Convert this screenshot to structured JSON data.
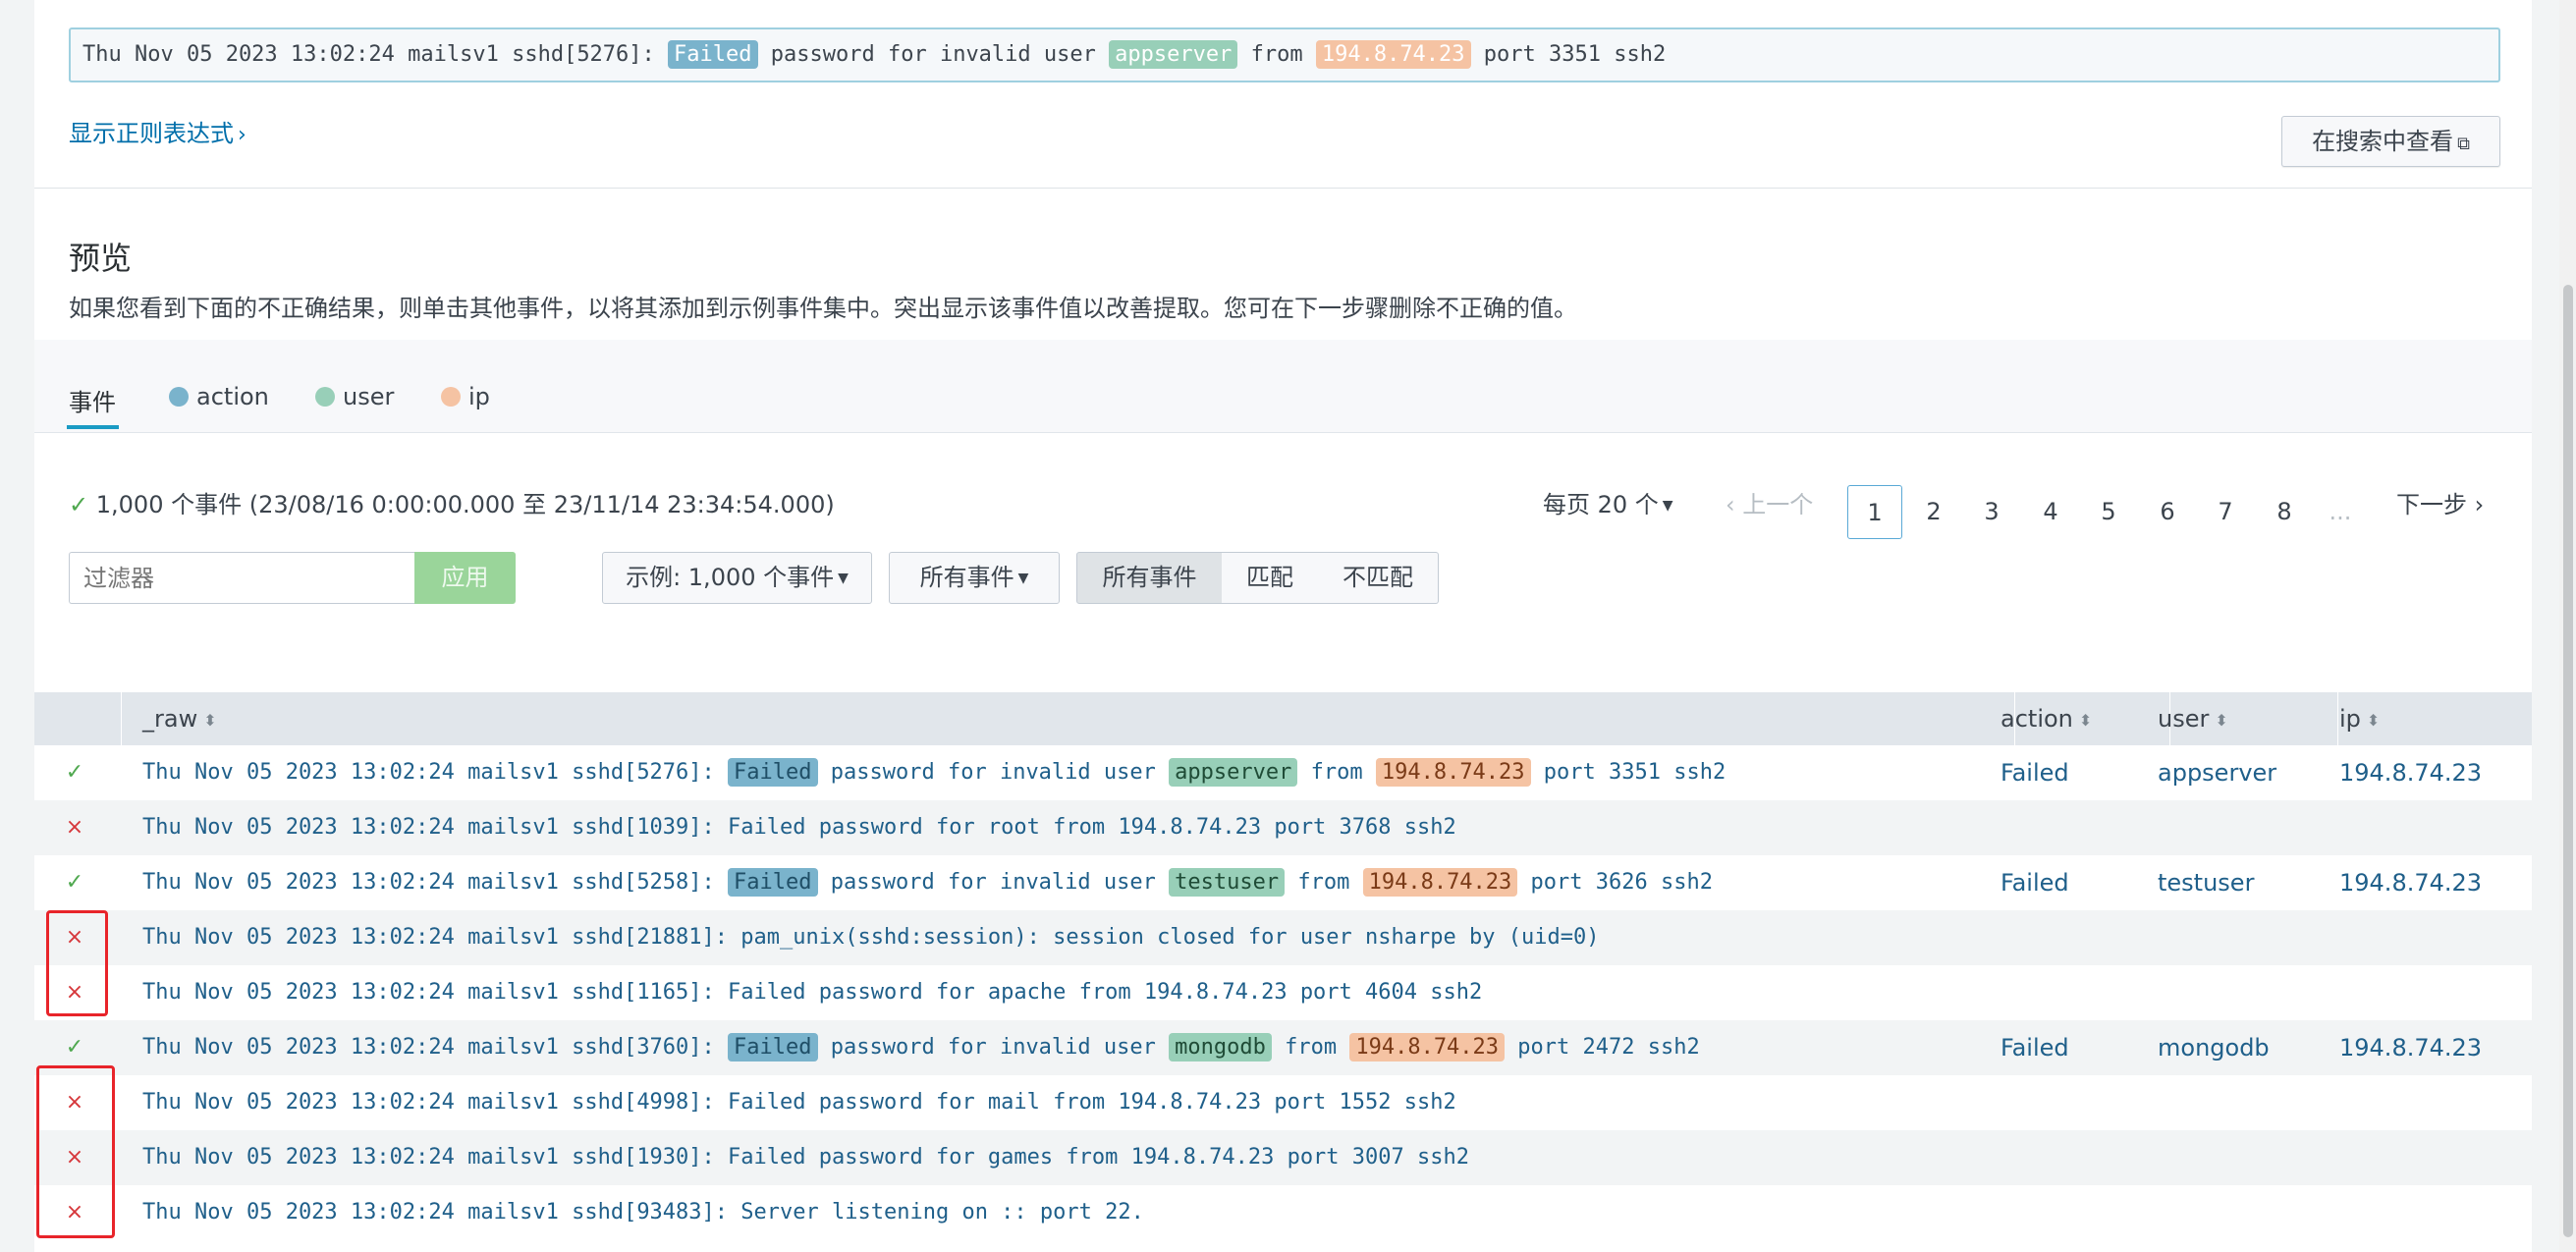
{
  "sample_event": {
    "prefix": "Thu Nov 05 2023 13:02:24 mailsv1 sshd[5276]: ",
    "action": "Failed",
    "middle1": " password for invalid user ",
    "user": "appserver",
    "middle2": " from ",
    "ip": "194.8.74.23",
    "suffix": " port 3351 ssh2"
  },
  "regex_link": "显示正则表达式",
  "view_in_search": "在搜索中查看",
  "preview": {
    "title": "预览",
    "description": "如果您看到下面的不正确结果，则单击其他事件，以将其添加到示例事件集中。突出显示该事件值以改善提取。您可在下一步骤删除不正确的值。"
  },
  "tabs": {
    "events": "事件",
    "action": "action",
    "user": "user",
    "ip": "ip"
  },
  "colors": {
    "action": "#7ab3cc",
    "user": "#98cfb8",
    "ip": "#f5c3a3",
    "accent": "#1a9bc4"
  },
  "event_count": "1,000 个事件 (23/08/16 0:00:00.000 至 23/11/14 23:34:54.000)",
  "filter": {
    "placeholder": "过滤器",
    "apply": "应用"
  },
  "sample_dropdown": "示例: 1,000 个事件",
  "all_events_dropdown": "所有事件",
  "match_segments": [
    "所有事件",
    "匹配",
    "不匹配"
  ],
  "pager": {
    "per_page": "每页 20 个",
    "prev": "上一个",
    "pages": [
      "1",
      "2",
      "3",
      "4",
      "5",
      "6",
      "7",
      "8"
    ],
    "ellipsis": "...",
    "next": "下一步",
    "current": "1"
  },
  "table": {
    "headers": {
      "raw": "_raw",
      "action": "action",
      "user": "user",
      "ip": "ip"
    },
    "rows": [
      {
        "ok": true,
        "prefix": "Thu Nov 05 2023 13:02:24 mailsv1 sshd[5276]: ",
        "action": "Failed",
        "middle1": " password for invalid user ",
        "user": "appserver",
        "middle2": " from ",
        "ip": "194.8.74.23",
        "suffix": " port 3351 ssh2",
        "col_action": "Failed",
        "col_user": "appserver",
        "col_ip": "194.8.74.23"
      },
      {
        "ok": false,
        "text": "Thu Nov 05 2023 13:02:24 mailsv1 sshd[1039]: Failed password for root from 194.8.74.23 port 3768 ssh2"
      },
      {
        "ok": true,
        "prefix": "Thu Nov 05 2023 13:02:24 mailsv1 sshd[5258]: ",
        "action": "Failed",
        "middle1": " password for invalid user ",
        "user": "testuser",
        "middle2": " from ",
        "ip": "194.8.74.23",
        "suffix": " port 3626 ssh2",
        "col_action": "Failed",
        "col_user": "testuser",
        "col_ip": "194.8.74.23"
      },
      {
        "ok": false,
        "text": "Thu Nov 05 2023 13:02:24 mailsv1 sshd[21881]: pam_unix(sshd:session): session closed for user nsharpe by (uid=0)"
      },
      {
        "ok": false,
        "text": "Thu Nov 05 2023 13:02:24 mailsv1 sshd[1165]: Failed password for apache from 194.8.74.23 port 4604 ssh2"
      },
      {
        "ok": true,
        "prefix": "Thu Nov 05 2023 13:02:24 mailsv1 sshd[3760]: ",
        "action": "Failed",
        "middle1": " password for invalid user ",
        "user": "mongodb",
        "middle2": " from ",
        "ip": "194.8.74.23",
        "suffix": " port 2472 ssh2",
        "col_action": "Failed",
        "col_user": "mongodb",
        "col_ip": "194.8.74.23"
      },
      {
        "ok": false,
        "text": "Thu Nov 05 2023 13:02:24 mailsv1 sshd[4998]: Failed password for mail from 194.8.74.23 port 1552 ssh2"
      },
      {
        "ok": false,
        "text": "Thu Nov 05 2023 13:02:24 mailsv1 sshd[1930]: Failed password for games from 194.8.74.23 port 3007 ssh2"
      },
      {
        "ok": false,
        "text": "Thu Nov 05 2023 13:02:24 mailsv1 sshd[93483]: Server listening on :: port 22."
      }
    ]
  },
  "icons": {
    "check": "✓",
    "cross": "×",
    "chevron_right": "›",
    "chevron_left": "‹",
    "caret_down": "▼",
    "sort": "⬍",
    "external_link": "⧉"
  }
}
